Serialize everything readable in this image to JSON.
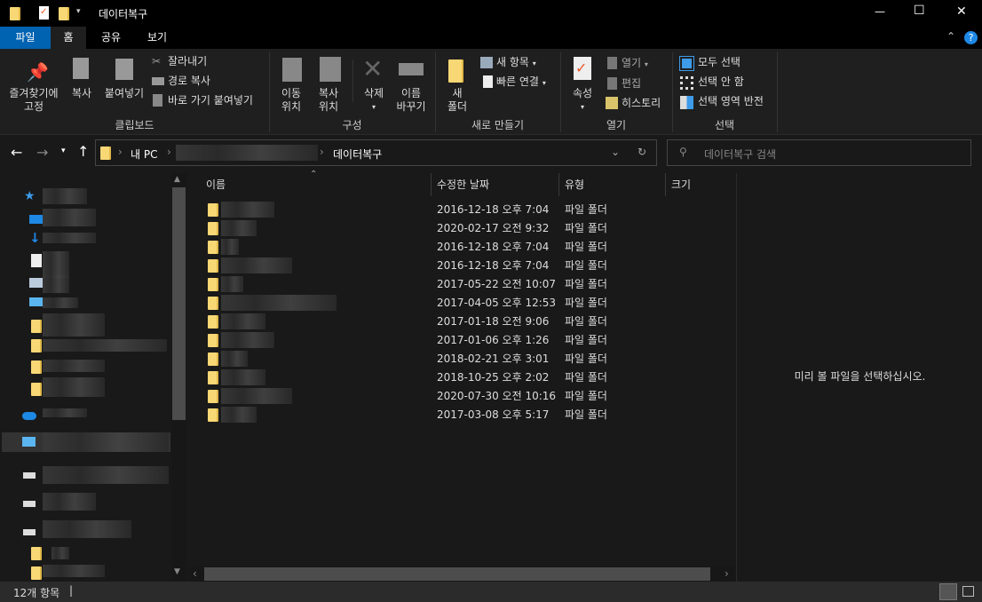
{
  "window": {
    "title": "데이터복구",
    "minimize": "—",
    "maximize": "☐",
    "close": "✕"
  },
  "tabs": [
    {
      "label": "파일"
    },
    {
      "label": "홈"
    },
    {
      "label": "공유"
    },
    {
      "label": "보기"
    }
  ],
  "ribbon": {
    "clipboard": {
      "pin": "즐겨찾기에",
      "pin2": "고정",
      "copy": "복사",
      "paste": "붙여넣기",
      "cut": "잘라내기",
      "copy_path": "경로 복사",
      "paste_shortcut": "바로 가기 붙여넣기",
      "label": "클립보드"
    },
    "organize": {
      "move1": "이동",
      "move2": "위치",
      "copyto1": "복사",
      "copyto2": "위치",
      "delete": "삭제",
      "rename1": "이름",
      "rename2": "바꾸기",
      "label": "구성"
    },
    "new": {
      "folder1": "새",
      "folder2": "폴더",
      "new_item": "새 항목",
      "easy_access": "빠른 연결",
      "label": "새로 만들기"
    },
    "open": {
      "properties": "속성",
      "open": "열기",
      "edit": "편집",
      "history": "히스토리",
      "label": "열기"
    },
    "select": {
      "select_all": "모두 선택",
      "select_none": "선택 안 함",
      "invert": "선택 영역 반전",
      "label": "선택"
    }
  },
  "address": {
    "pc": "내 PC",
    "current": "데이터복구"
  },
  "search": {
    "placeholder": "데이터복구 검색"
  },
  "columns": {
    "name": "이름",
    "date": "수정한 날짜",
    "type": "유형",
    "size": "크기"
  },
  "files": [
    {
      "date": "2016-12-18 오후 7:04",
      "type": "파일 폴더"
    },
    {
      "date": "2020-02-17 오전 9:32",
      "type": "파일 폴더"
    },
    {
      "date": "2016-12-18 오후 7:04",
      "type": "파일 폴더"
    },
    {
      "date": "2016-12-18 오후 7:04",
      "type": "파일 폴더"
    },
    {
      "date": "2017-05-22 오전 10:07",
      "type": "파일 폴더"
    },
    {
      "date": "2017-04-05 오후 12:53",
      "type": "파일 폴더"
    },
    {
      "date": "2017-01-18 오전 9:06",
      "type": "파일 폴더"
    },
    {
      "date": "2017-01-06 오후 1:26",
      "type": "파일 폴더"
    },
    {
      "date": "2018-02-21 오후 3:01",
      "type": "파일 폴더"
    },
    {
      "date": "2018-10-25 오후 2:02",
      "type": "파일 폴더"
    },
    {
      "date": "2020-07-30 오전 10:16",
      "type": "파일 폴더"
    },
    {
      "date": "2017-03-08 오후 5:17",
      "type": "파일 폴더"
    }
  ],
  "preview": {
    "message": "미리 볼 파일을 선택하십시오."
  },
  "status": {
    "count": "12개 항목"
  },
  "colors": {
    "accent": "#0063b1",
    "folder": "#f8d775"
  }
}
